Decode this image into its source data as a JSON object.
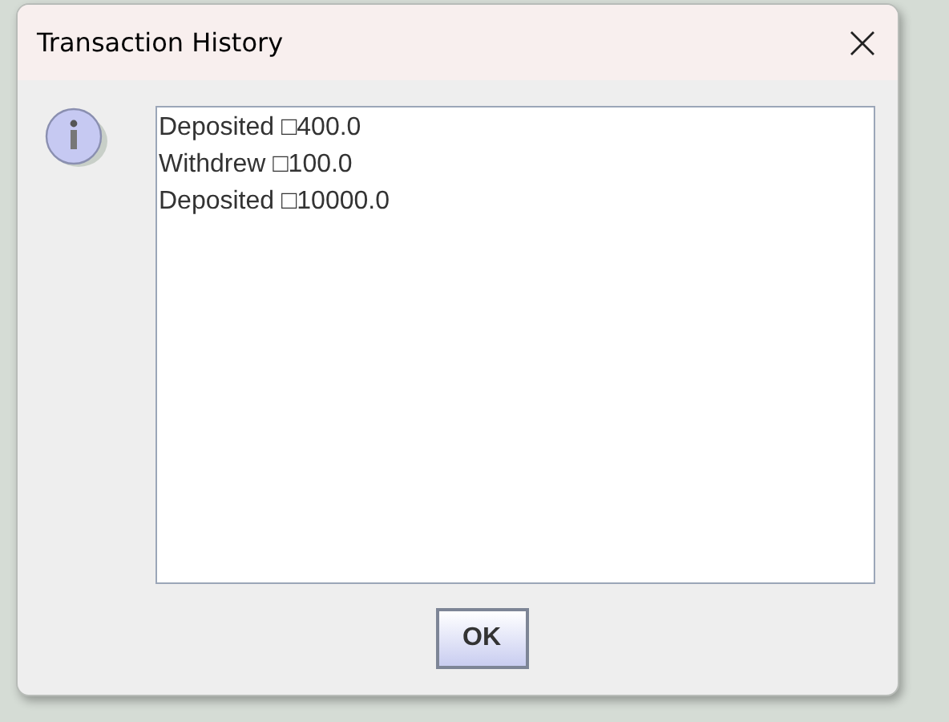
{
  "window": {
    "title": "Transaction History"
  },
  "history": [
    "Deposited □400.0",
    "Withdrew □100.0",
    "Deposited □10000.0"
  ],
  "buttons": [
    "OK"
  ]
}
